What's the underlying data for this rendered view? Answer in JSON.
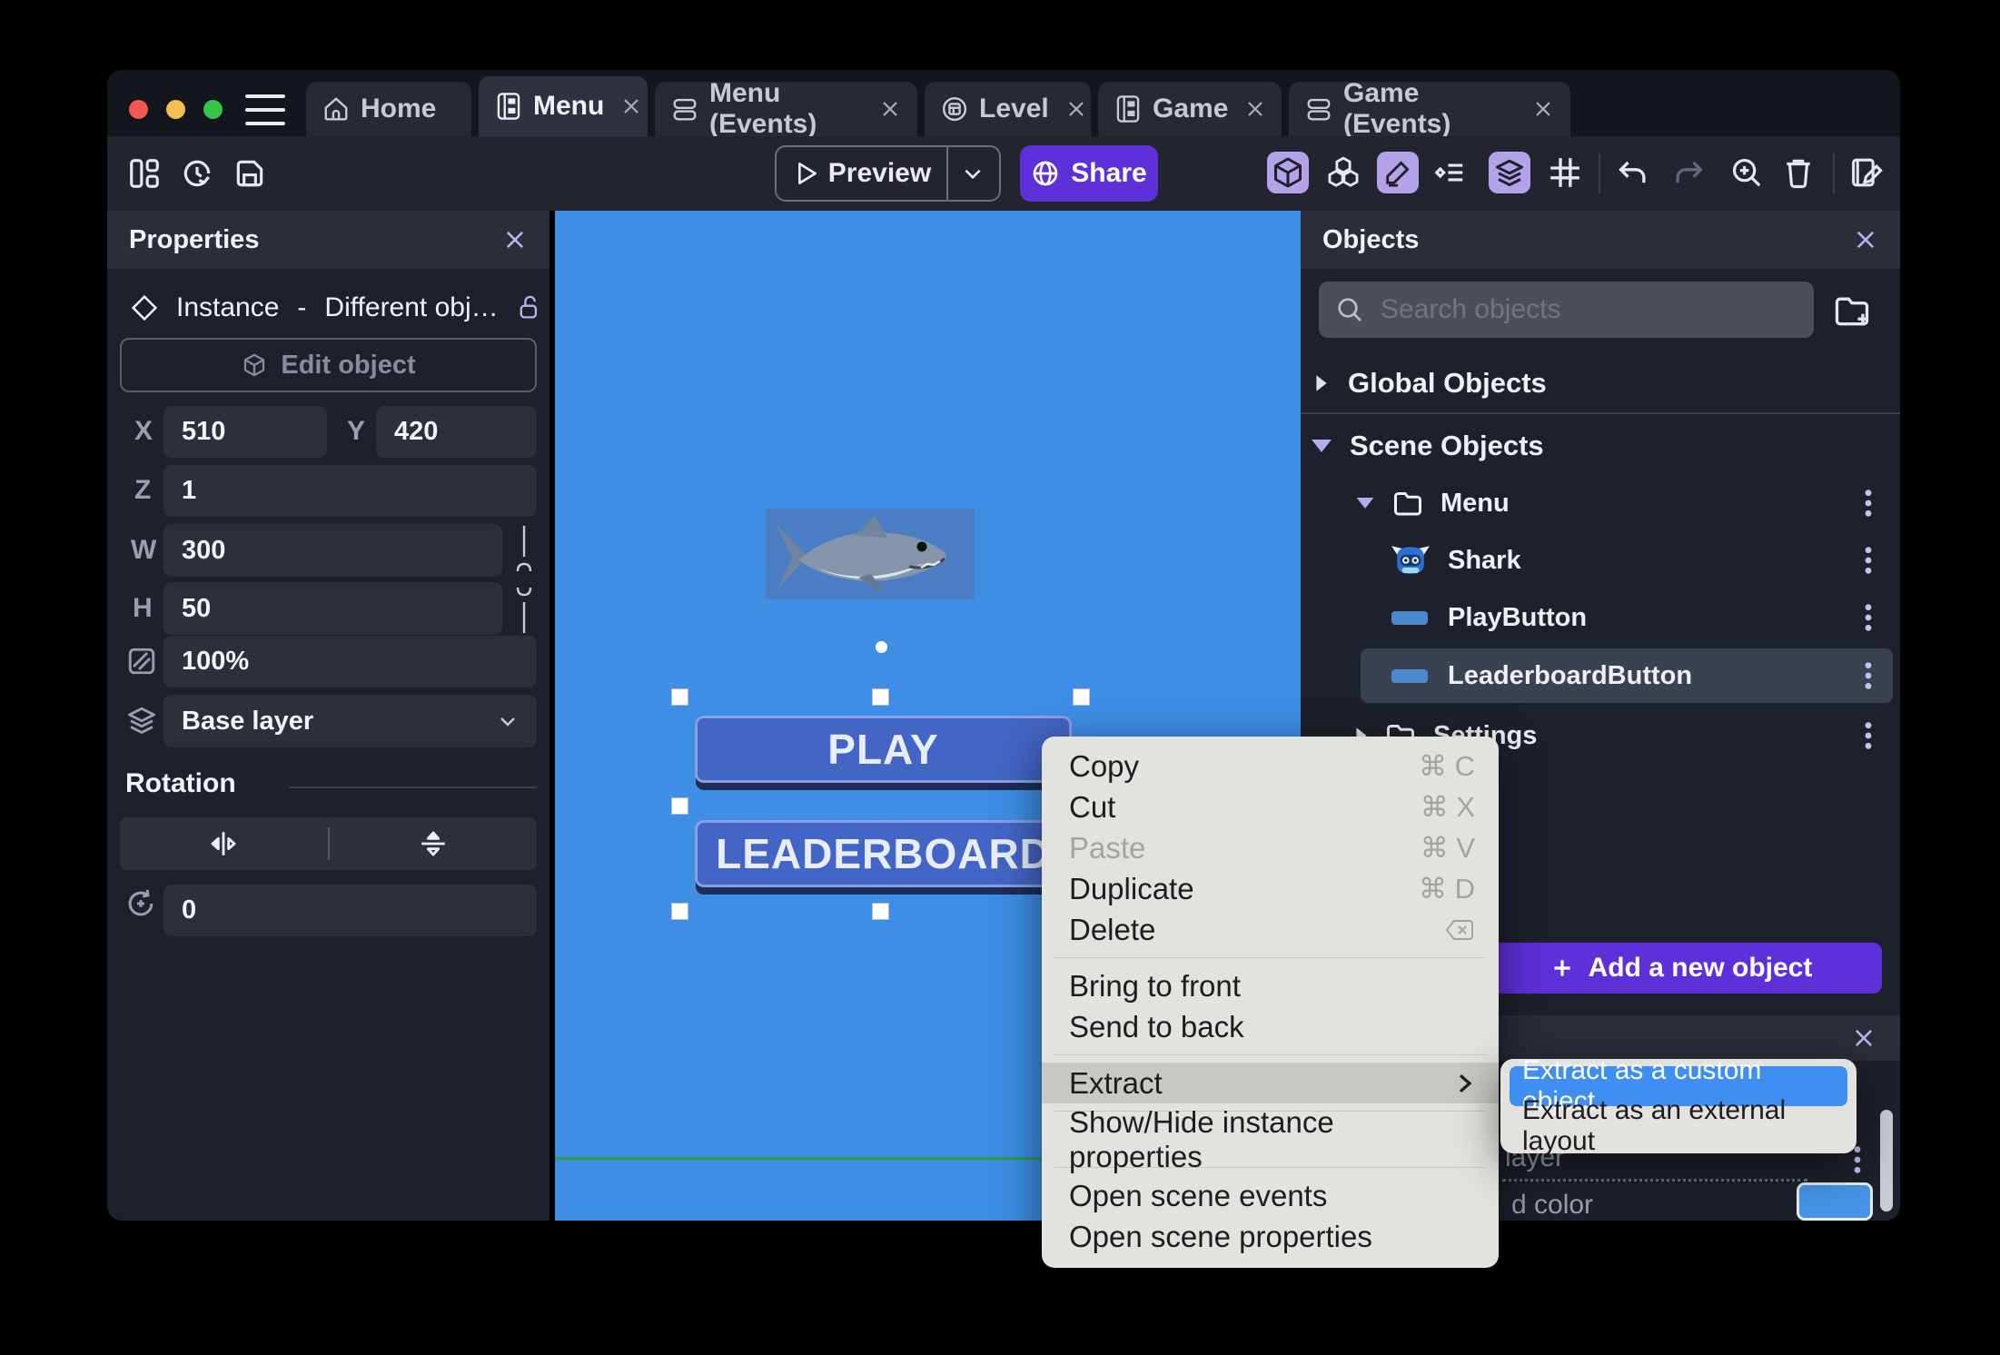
{
  "colors": {
    "accent_purple": "#5e30da",
    "toolbar_toggle_purple": "#b3a2ea",
    "canvas_blue": "#3e8ee6",
    "game_button_blue": "#4365c5",
    "submenu_selection_blue": "#3f8ef2",
    "context_menu_bg": "#e3e2de",
    "selected_row_bg": "#3a4150"
  },
  "window_tabs": {
    "items": [
      {
        "label": "Home",
        "icon": "home-icon",
        "closable": false
      },
      {
        "label": "Menu",
        "icon": "scene-icon",
        "closable": true,
        "active": true
      },
      {
        "label": "Menu (Events)",
        "icon": "events-icon",
        "closable": true
      },
      {
        "label": "Level",
        "icon": "external-layout-icon",
        "closable": true
      },
      {
        "label": "Game",
        "icon": "scene-icon",
        "closable": true
      },
      {
        "label": "Game (Events)",
        "icon": "events-icon",
        "closable": true
      }
    ]
  },
  "toolbar": {
    "preview_label": "Preview",
    "share_label": "Share"
  },
  "properties_panel": {
    "title": "Properties",
    "instance_type": "Instance",
    "separator": "-",
    "instance_name": "Different obj…",
    "edit_object_label": "Edit object",
    "fields": {
      "x_label": "X",
      "x_value": "510",
      "y_label": "Y",
      "y_value": "420",
      "z_label": "Z",
      "z_value": "1",
      "w_label": "W",
      "w_value": "300",
      "h_label": "H",
      "h_value": "50",
      "opacity_value": "100%",
      "layer_value": "Base layer",
      "rotation_title": "Rotation",
      "angle_value": "0"
    }
  },
  "canvas": {
    "play_button_label": "PLAY",
    "leaderboard_button_label": "LEADERBOARD"
  },
  "context_menu": {
    "items": [
      {
        "label": "Copy",
        "shortcut": "⌘ C"
      },
      {
        "label": "Cut",
        "shortcut": "⌘ X"
      },
      {
        "label": "Paste",
        "shortcut": "⌘ V",
        "disabled": true
      },
      {
        "label": "Duplicate",
        "shortcut": "⌘ D"
      },
      {
        "label": "Delete"
      },
      {
        "label": "Bring to front"
      },
      {
        "label": "Send to back"
      },
      {
        "label": "Extract",
        "has_submenu": true,
        "highlighted": true
      },
      {
        "label": "Show/Hide instance properties"
      },
      {
        "label": "Open scene events"
      },
      {
        "label": "Open scene properties"
      }
    ],
    "submenu": {
      "items": [
        {
          "label": "Extract as a custom object",
          "selected": true
        },
        {
          "label": "Extract as an external layout",
          "selected": false
        }
      ]
    }
  },
  "objects_panel": {
    "title": "Objects",
    "search_placeholder": "Search objects",
    "global_section_label": "Global Objects",
    "scene_section_label": "Scene Objects",
    "tree": {
      "menu_folder_label": "Menu",
      "shark_label": "Shark",
      "play_button_label": "PlayButton",
      "leaderboard_button_label": "LeaderboardButton",
      "settings_folder_label": "Settings"
    },
    "add_object_label": "Add a new object",
    "bottom_panel": {
      "layer_fragment": "layer",
      "color_fragment": "d color"
    }
  }
}
